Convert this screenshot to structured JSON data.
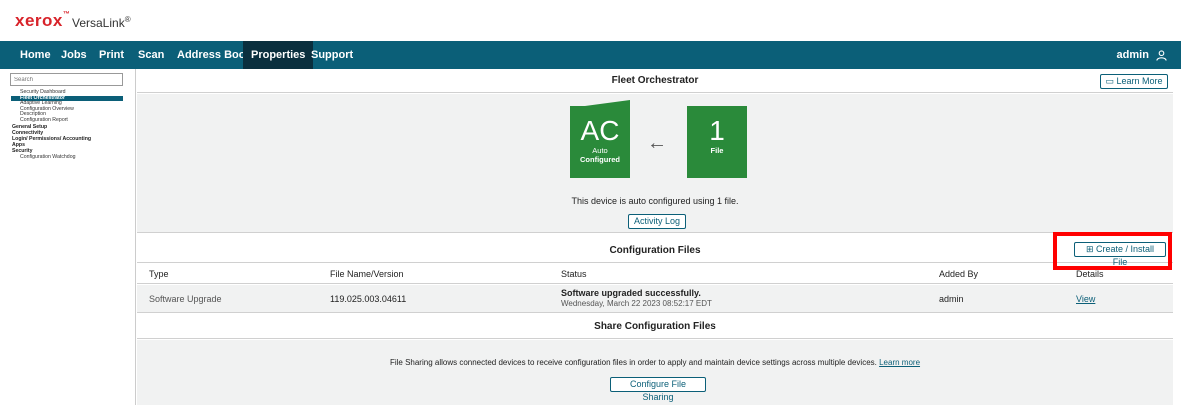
{
  "header": {
    "logo": "xerox",
    "product": "VersaLink",
    "product_mark": "®"
  },
  "nav": {
    "items": [
      {
        "label": "Home"
      },
      {
        "label": "Jobs"
      },
      {
        "label": "Print"
      },
      {
        "label": "Scan"
      },
      {
        "label": "Address Book"
      },
      {
        "label": "Properties",
        "active": true
      },
      {
        "label": "Support"
      }
    ],
    "user": "admin",
    "user_icon": "user-icon"
  },
  "sidebar": {
    "search_placeholder": "Search",
    "items": [
      {
        "label": "Security Dashboard",
        "type": "item"
      },
      {
        "label": "Fleet Orchestrator",
        "type": "item",
        "active": true
      },
      {
        "label": "Adaptive Learning",
        "type": "item"
      },
      {
        "label": "Configuration Overview",
        "type": "item"
      },
      {
        "label": "Description",
        "type": "item"
      },
      {
        "label": "Configuration Report",
        "type": "item"
      },
      {
        "label": "General Setup",
        "type": "group"
      },
      {
        "label": "Connectivity",
        "type": "group"
      },
      {
        "label": "Login/ Permissions/ Accounting",
        "type": "group"
      },
      {
        "label": "Apps",
        "type": "group"
      },
      {
        "label": "Security",
        "type": "group"
      },
      {
        "label": "Configuration Watchdog",
        "type": "item"
      }
    ]
  },
  "fleet": {
    "title": "Fleet Orchestrator",
    "learn_more": "Learn More",
    "tile_left": {
      "big": "AC",
      "line1": "Auto",
      "line2": "Configured"
    },
    "tile_right": {
      "big": "1",
      "line1": "File"
    },
    "arrow": "←",
    "status_text": "This device is auto configured using 1 file.",
    "activity_log": "Activity Log"
  },
  "config_files": {
    "title": "Configuration Files",
    "create_button": "Create / Install File",
    "columns": [
      "Type",
      "File Name/Version",
      "Status",
      "Added By",
      "Details"
    ],
    "rows": [
      {
        "type": "Software Upgrade",
        "file": "119.025.003.04611",
        "status_main": "Software upgraded successfully.",
        "status_date": "Wednesday, March 22 2023 08:52:17 EDT",
        "added_by": "admin",
        "details": "View"
      }
    ]
  },
  "share": {
    "title": "Share Configuration Files",
    "description": "File Sharing allows connected devices to receive configuration files in order to apply and maintain device settings across multiple devices.",
    "learn_more": "Learn more",
    "button": "Configure File Sharing"
  },
  "colors": {
    "nav_bg": "#0b5f78",
    "nav_active": "#0a2f3e",
    "tile_green": "#2a8a3a",
    "highlight": "#ff0000",
    "brand_red": "#d8232a"
  }
}
